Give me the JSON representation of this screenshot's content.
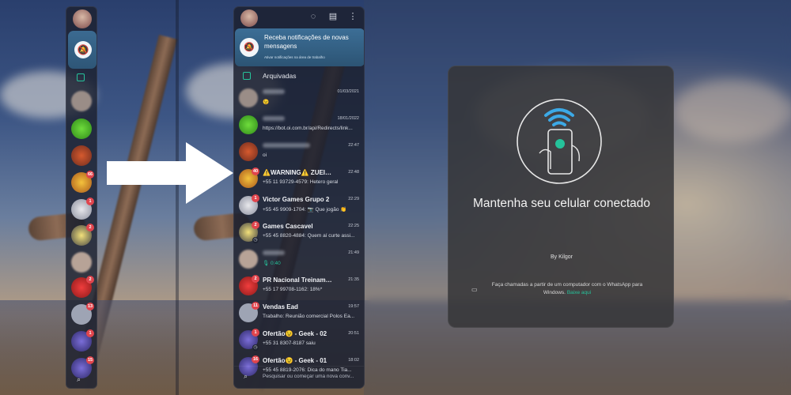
{
  "banner": {
    "title": "Receba notificações de novas mensagens",
    "subtitle": "Ativar notificações na área de trabalho"
  },
  "archived": {
    "label": "Arquivadas"
  },
  "chats": [
    {
      "name": "",
      "time": "01/03/2021",
      "message": "😉",
      "name_hidden": true
    },
    {
      "name": "",
      "time": "18/01/2022",
      "message": "https://bot.oi.com.br/api/Redirects/link...",
      "name_hidden": true
    },
    {
      "name": "",
      "time": "22:47",
      "message": "oi",
      "name_hidden": true
    },
    {
      "name": "⚠️WARNING⚠️ ZUEIRA D...",
      "time": "22:48",
      "message": "+55 11 93729-4579: Hetero geral",
      "badge": "40"
    },
    {
      "name": "Victor Games Grupo 2",
      "time": "22:29",
      "message": "+55 45 9909-1704: 📷 Que jogão 👏",
      "badge": "1"
    },
    {
      "name": "Games Cascavel",
      "time": "22:25",
      "message": "+55 45 8820-4884: Quem aí curte assi...",
      "badge": "2"
    },
    {
      "name": "",
      "time": "21:49",
      "message": "🎙 0:40",
      "name_hidden": true
    },
    {
      "name": "PR Nacional Treinamentos",
      "time": "21:35",
      "message": "+55 17 99708-1162: 18%*",
      "badge": "2"
    },
    {
      "name": "Vendas Ead",
      "time": "19:57",
      "message": "Trabalho: Reunião comercial Polos Ea...",
      "badge": "11"
    },
    {
      "name": "Ofertão😉 - Geek - 02",
      "time": "20:51",
      "message": "+55 31 8307-8187 saiu",
      "badge": "1"
    },
    {
      "name": "Ofertão😉 - Geek - 01",
      "time": "18:02",
      "message": "+55 45 8819-2076: Dica do mano Tia...",
      "badge": "16"
    }
  ],
  "mini_badges": [
    "66",
    "1",
    "2",
    "2",
    "13",
    "1",
    "15"
  ],
  "search": {
    "placeholder": "Pesquisar ou começar uma nova conv..."
  },
  "card": {
    "title": "Mantenha seu celular conectado",
    "byline": "By Kilgor",
    "footer_text": "Faça chamadas a partir de um computador com o WhatsApp para Windows.",
    "footer_link": "Baixe aqui"
  },
  "colors": {
    "accent": "#25c39b",
    "badge": "#e0454d",
    "banner": "#3b6a91"
  }
}
